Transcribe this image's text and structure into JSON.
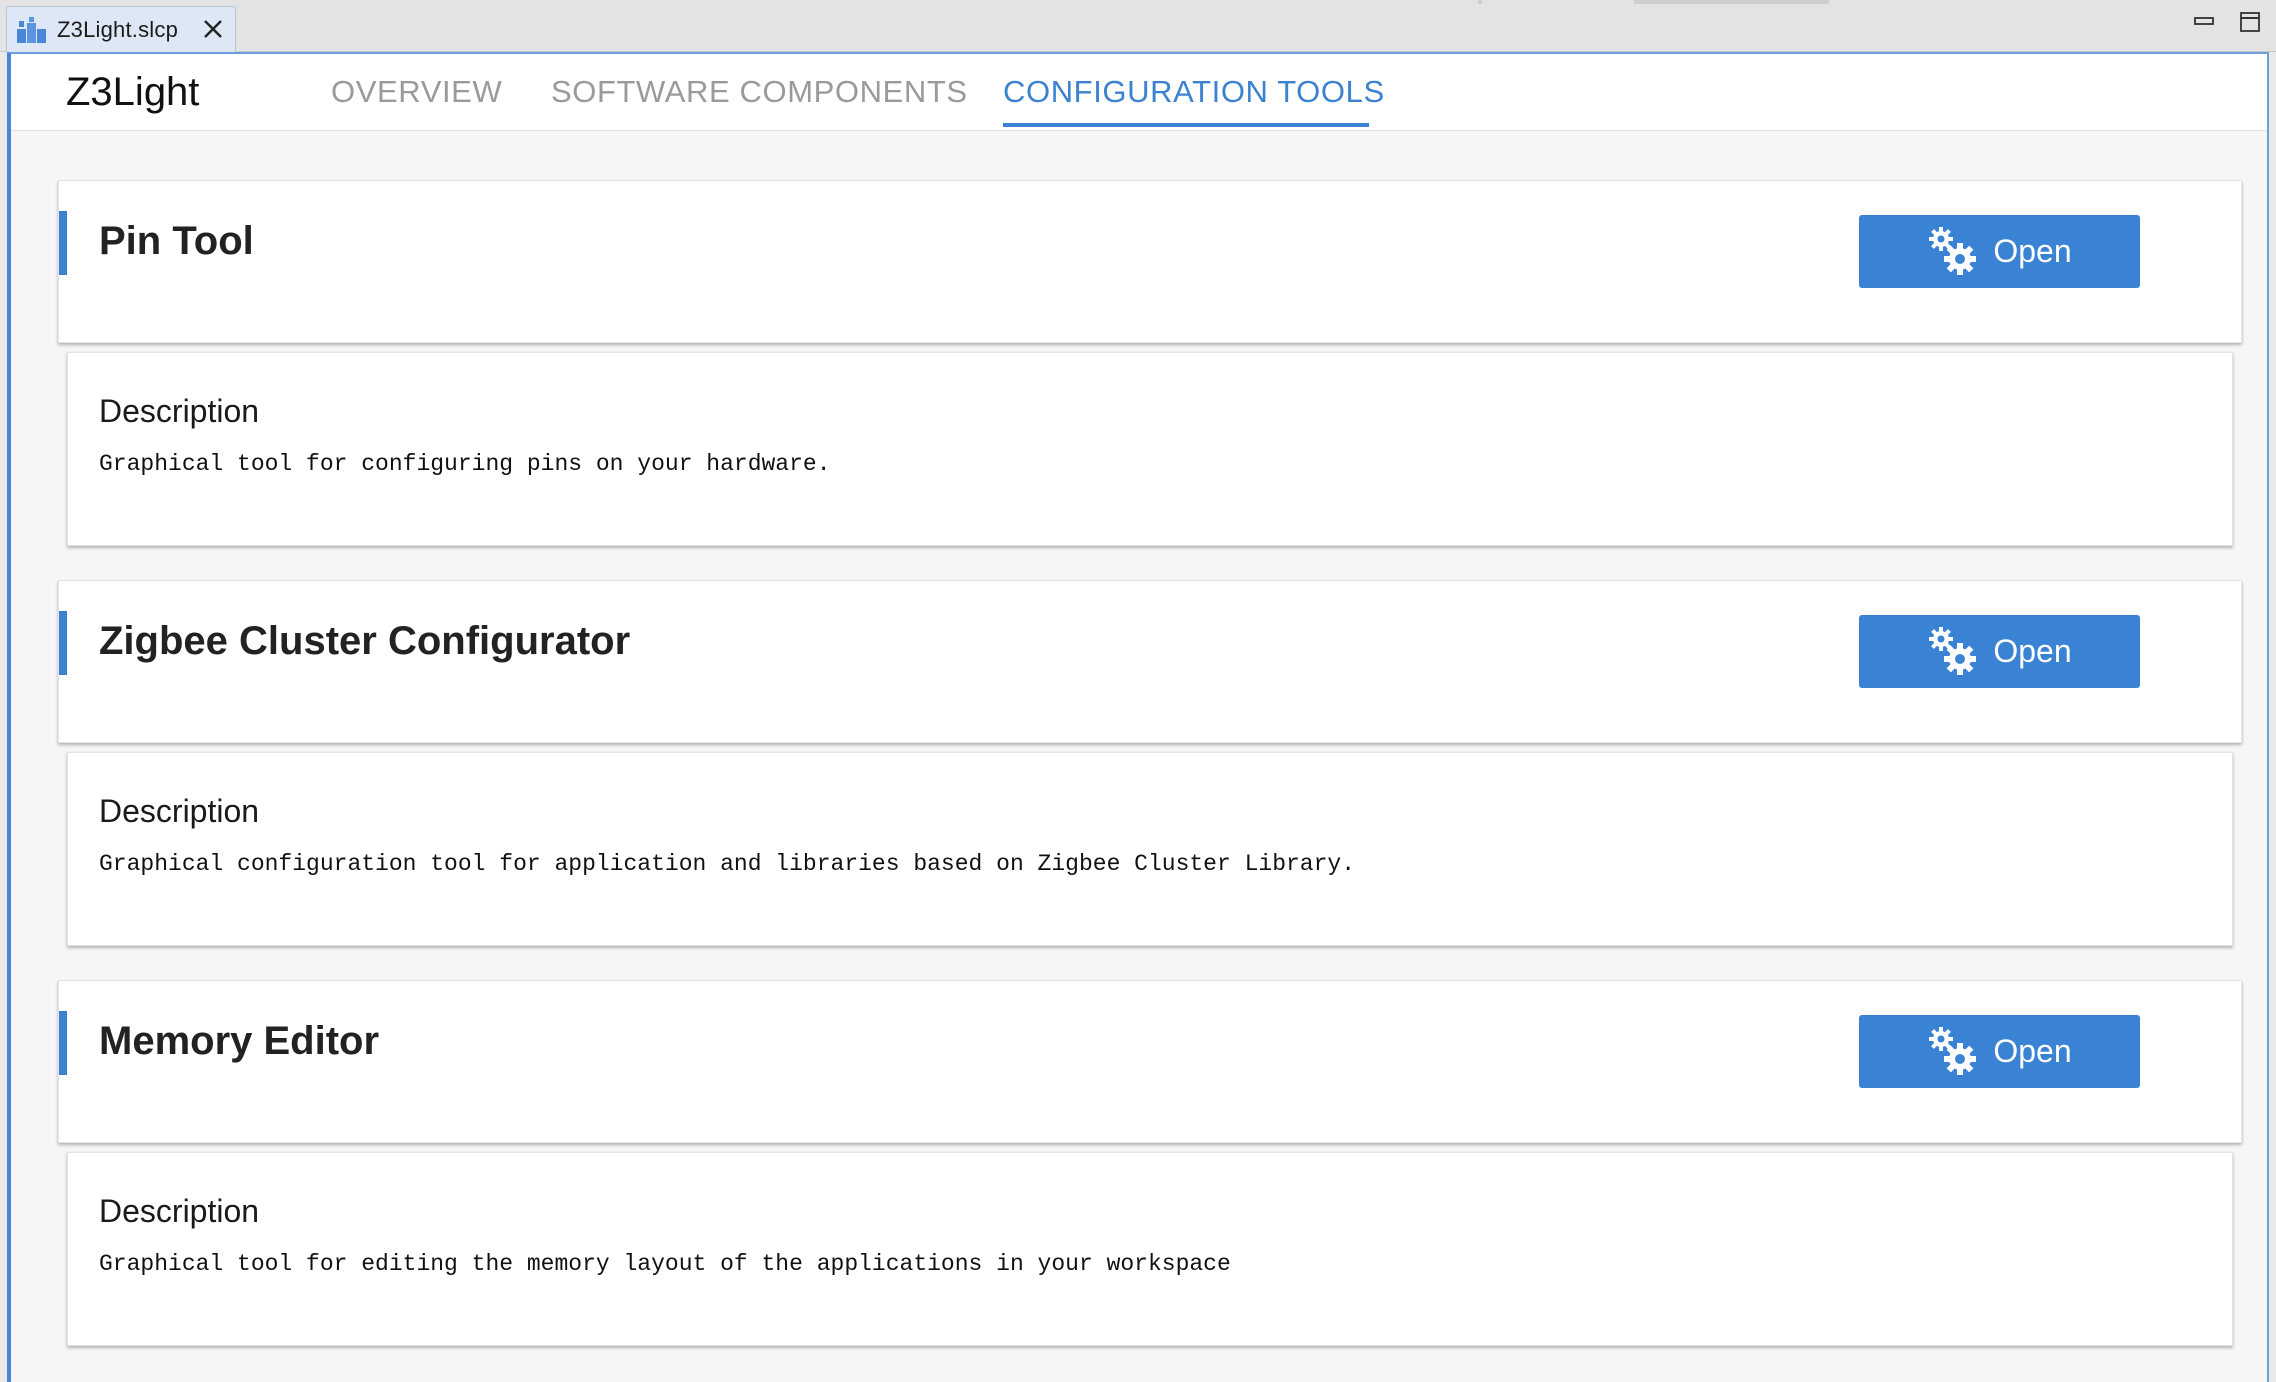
{
  "editor_tab": {
    "label": "Z3Light.slcp",
    "icon": "project-icon"
  },
  "header": {
    "title": "Z3Light",
    "tabs": [
      {
        "label": "OVERVIEW",
        "active": false
      },
      {
        "label": "SOFTWARE COMPONENTS",
        "active": false
      },
      {
        "label": "CONFIGURATION TOOLS",
        "active": true
      }
    ]
  },
  "tools": [
    {
      "title": "Pin Tool",
      "button_label": "Open",
      "description_heading": "Description",
      "description": "Graphical tool for configuring pins on your hardware."
    },
    {
      "title": "Zigbee Cluster Configurator",
      "button_label": "Open",
      "description_heading": "Description",
      "description": "Graphical configuration tool for application and libraries based on Zigbee Cluster Library."
    },
    {
      "title": "Memory Editor",
      "button_label": "Open",
      "description_heading": "Description",
      "description": "Graphical tool for editing the memory layout of the applications in your workspace"
    }
  ],
  "colors": {
    "accent": "#3b82d0",
    "button": "#3a82d3",
    "inactive_tab": "#9a9a9a"
  }
}
